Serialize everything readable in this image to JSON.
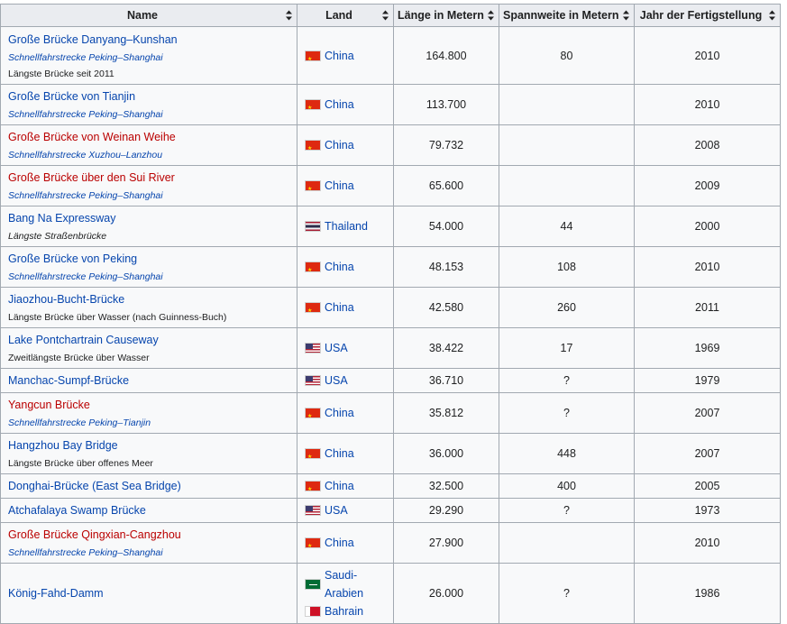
{
  "headers": [
    "Name",
    "Land",
    "Länge in Metern",
    "Spannweite in Metern",
    "Jahr der Fertigstellung"
  ],
  "rows": [
    {
      "name": "Große Brücke Danyang–Kunshan",
      "name_link": "link",
      "sub": "Schnellfahrstrecke Peking–Shanghai",
      "sub_type": "link-italic",
      "sub2": "Längste Brücke seit 2011",
      "countries": [
        {
          "flag": "china",
          "name": "China"
        }
      ],
      "length": "164.800",
      "span": "80",
      "year": "2010"
    },
    {
      "name": "Große Brücke von Tianjin",
      "name_link": "link",
      "sub": "Schnellfahrstrecke Peking–Shanghai",
      "sub_type": "link-italic",
      "countries": [
        {
          "flag": "china",
          "name": "China"
        }
      ],
      "length": "113.700",
      "span": "",
      "year": "2010"
    },
    {
      "name": "Große Brücke von Weinan Weihe",
      "name_link": "redlink",
      "sub": "Schnellfahrstrecke Xuzhou–Lanzhou",
      "sub_type": "link-italic",
      "countries": [
        {
          "flag": "china",
          "name": "China"
        }
      ],
      "length": "79.732",
      "span": "",
      "year": "2008"
    },
    {
      "name": "Große Brücke über den Sui River",
      "name_link": "redlink",
      "sub": "Schnellfahrstrecke Peking–Shanghai",
      "sub_type": "link-italic",
      "countries": [
        {
          "flag": "china",
          "name": "China"
        }
      ],
      "length": "65.600",
      "span": "",
      "year": "2009"
    },
    {
      "name": "Bang Na Expressway",
      "name_link": "link",
      "sub": "Längste Straßenbrücke",
      "sub_type": "text-italic",
      "countries": [
        {
          "flag": "thailand",
          "name": "Thailand"
        }
      ],
      "length": "54.000",
      "span": "44",
      "year": "2000"
    },
    {
      "name": "Große Brücke von Peking",
      "name_link": "link",
      "sub": "Schnellfahrstrecke Peking–Shanghai",
      "sub_type": "link-italic",
      "countries": [
        {
          "flag": "china",
          "name": "China"
        }
      ],
      "length": "48.153",
      "span": "108",
      "year": "2010"
    },
    {
      "name": "Jiaozhou-Bucht-Brücke",
      "name_link": "link",
      "sub": "Längste Brücke über Wasser (nach Guinness-Buch)",
      "sub_type": "text",
      "countries": [
        {
          "flag": "china",
          "name": "China"
        }
      ],
      "length": "42.580",
      "span": "260",
      "year": "2011"
    },
    {
      "name": "Lake Pontchartrain Causeway",
      "name_link": "link",
      "sub": "Zweitlängste Brücke über Wasser",
      "sub_type": "text",
      "countries": [
        {
          "flag": "usa",
          "name": "USA"
        }
      ],
      "length": "38.422",
      "span": "17",
      "year": "1969"
    },
    {
      "name": "Manchac-Sumpf-Brücke",
      "name_link": "link",
      "countries": [
        {
          "flag": "usa",
          "name": "USA"
        }
      ],
      "length": "36.710",
      "span": "?",
      "year": "1979"
    },
    {
      "name": "Yangcun Brücke",
      "name_link": "redlink",
      "sub": "Schnellfahrstrecke Peking–Tianjin",
      "sub_type": "link-italic",
      "countries": [
        {
          "flag": "china",
          "name": "China"
        }
      ],
      "length": "35.812",
      "span": "?",
      "year": "2007"
    },
    {
      "name": "Hangzhou Bay Bridge",
      "name_link": "link",
      "sub": "Längste Brücke über offenes Meer",
      "sub_type": "text",
      "countries": [
        {
          "flag": "china",
          "name": "China"
        }
      ],
      "length": "36.000",
      "span": "448",
      "year": "2007"
    },
    {
      "name": "Donghai-Brücke (East Sea Bridge)",
      "name_link": "link",
      "countries": [
        {
          "flag": "china",
          "name": "China"
        }
      ],
      "length": "32.500",
      "span": "400",
      "year": "2005"
    },
    {
      "name": "Atchafalaya Swamp Brücke",
      "name_link": "link",
      "countries": [
        {
          "flag": "usa",
          "name": "USA"
        }
      ],
      "length": "29.290",
      "span": "?",
      "year": "1973"
    },
    {
      "name": "Große Brücke Qingxian-Cangzhou",
      "name_link": "redlink",
      "sub": "Schnellfahrstrecke Peking–Shanghai",
      "sub_type": "link-italic",
      "countries": [
        {
          "flag": "china",
          "name": "China"
        }
      ],
      "length": "27.900",
      "span": "",
      "year": "2010"
    },
    {
      "name": "König-Fahd-Damm",
      "name_link": "link",
      "countries": [
        {
          "flag": "saudi",
          "name": "Saudi-Arabien"
        },
        {
          "flag": "bahrain",
          "name": "Bahrain"
        }
      ],
      "length": "26.000",
      "span": "?",
      "year": "1986"
    }
  ]
}
